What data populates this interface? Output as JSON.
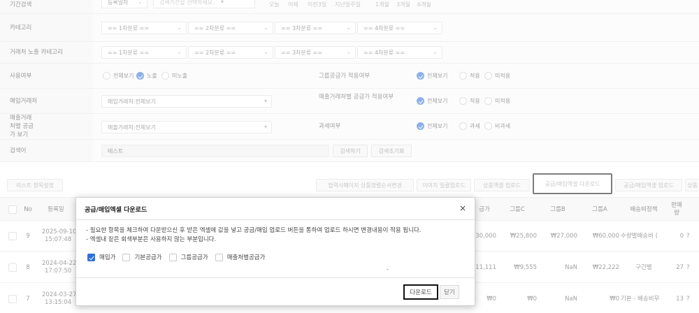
{
  "form": {
    "period": {
      "label": "기간검색",
      "select": "등록일자",
      "date_placeholder": "검색기간을 선택하세요.",
      "quick": [
        "오늘",
        "어제",
        "이전3일",
        "지난일주일",
        "1개월",
        "3개월",
        "6개월"
      ]
    },
    "category": {
      "label": "카테고리",
      "selects": [
        "== 1차분류 ==",
        "== 2차분류 ==",
        "== 3차분류 ==",
        "== 4차분류 =="
      ]
    },
    "vendor_category": {
      "label": "거래처 노출 카테고리",
      "selects": [
        "== 1차분류 ==",
        "== 2차분류 ==",
        "== 3차분류 ==",
        "== 4차분류 =="
      ]
    },
    "usage": {
      "label": "사용여부",
      "options": [
        "전체보기",
        "노출",
        "미노출"
      ],
      "selected": 1
    },
    "group_supply": {
      "label": "그룹공급가 적용여부",
      "options": [
        "전체보기",
        "적용",
        "미적용"
      ],
      "selected": 0
    },
    "purchase_vendor": {
      "label": "매입거래처",
      "value": "매입거래처:전체보기"
    },
    "sales_vendor_supply": {
      "label": "매출거래처별 공급가 적용여부",
      "options": [
        "전체보기",
        "적용",
        "미적용"
      ],
      "selected": 0
    },
    "sales_vendor_view": {
      "label": "매출거래처별 공급가 보기",
      "value": "매출거래처:전체보기"
    },
    "tax": {
      "label": "과세여부",
      "options": [
        "전체보기",
        "과세",
        "비과세"
      ],
      "selected": 0
    },
    "keyword": {
      "label": "검색어",
      "value": "테스트",
      "search_btn": "검색하기",
      "reset_btn": "검색초기화"
    }
  },
  "toolbar": {
    "list_settings": "리스트 항목설정",
    "buttons": [
      "협력사페이지 상품정렬순서변경",
      "이미지 일괄업로드",
      "상품엑셀 업로드",
      "공급/매입엑셀 다운로드",
      "공급/매입엑셀 업로드",
      "상품"
    ]
  },
  "table": {
    "headers": {
      "no": "No",
      "date": "등록일",
      "supply": "급가",
      "groupC": "그룹C",
      "groupB": "그룹B",
      "groupA": "그룹A",
      "shipping": "배송비정책",
      "sale": "판매량"
    },
    "rows": [
      {
        "no": "9",
        "date": "2025-09-10",
        "time": "15:07:48",
        "supply": "30,000",
        "groupC": "₩25,800",
        "groupB": "₩27,000",
        "groupA": "₩60,000",
        "shipping": "수량별배송비 (",
        "sale": "0",
        "extra": "?"
      },
      {
        "no": "8",
        "date": "2024-04-22",
        "time": "17:07:50",
        "supply": "11,111",
        "groupC": "₩9,555",
        "groupB": "NaN",
        "groupA": "₩22,222",
        "shipping": "구간별",
        "sale": "27",
        "extra": "?"
      },
      {
        "no": "7",
        "date": "2024-03-27",
        "time": "13:15:04",
        "supply": "₩0",
        "groupC": "₩0",
        "groupB": "NaN",
        "groupA": "₩0",
        "shipping": "기본 - 배송비무",
        "sale": "13",
        "extra": "?"
      }
    ]
  },
  "modal": {
    "title": "공급/매입엑셀 다운로드",
    "close": "×",
    "notes": [
      "- 필요한 항목을 체크하여 다운받으신 후 받은 엑셀에 값을 넣고 공급/매입 업로드 버튼을 통하여 업로드 하시면 변경내용이 적용 됩니다.",
      "- 엑셀내 짙은 회색부분은 사용하지 않는 부분입니다."
    ],
    "options": [
      {
        "label": "매입가",
        "checked": true
      },
      {
        "label": "기본공급가",
        "checked": false
      },
      {
        "label": "그룹공급가",
        "checked": false
      },
      {
        "label": "매출처별공급가",
        "checked": false
      }
    ],
    "download": "다운로드",
    "close_btn": "닫기",
    "footnote": "-"
  },
  "colors": {
    "accent": "#2f6fd8",
    "label_bg": "#f5f5f5",
    "highlight_border": "#111111"
  }
}
